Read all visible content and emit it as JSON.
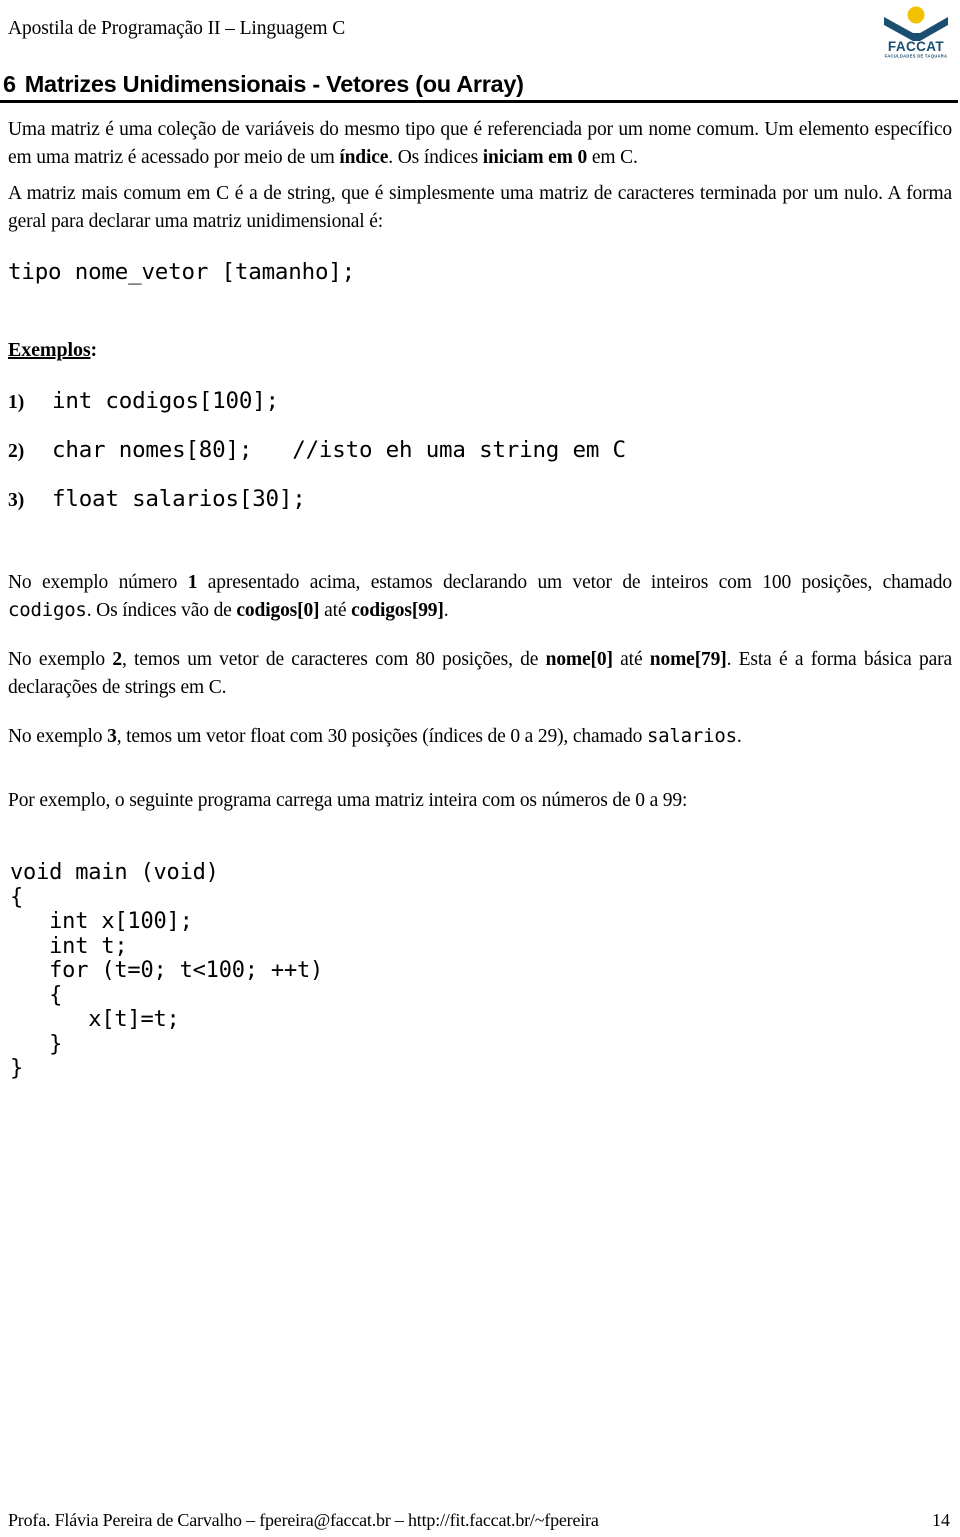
{
  "header": {
    "title": "Apostila de Programação II – Linguagem C",
    "logo": {
      "name": "FACCAT",
      "tagline": "FACULDADES DE TAQUARA",
      "colors": {
        "blue": "#1b4f72",
        "yellow": "#f2c200"
      }
    }
  },
  "section": {
    "number": "6",
    "title": "Matrizes Unidimensionais - Vetores (ou Array)"
  },
  "paragraphs": {
    "intro_a": "Uma matriz é uma coleção de variáveis do mesmo tipo que é referenciada por um nome comum. Um elemento específico em uma matriz é acessado por meio de um ",
    "intro_a_b1": "índice",
    "intro_a_mid": ". Os índices ",
    "intro_a_b2": "iniciam em 0",
    "intro_a_end": " em C.",
    "intro_b": "A matriz mais comum em C é a de string, que é simplesmente uma matriz de caracteres terminada por um nulo. A forma geral para declarar uma matriz unidimensional é:"
  },
  "declaration": "tipo nome_vetor [tamanho];",
  "examples_heading": {
    "label": "Exemplos",
    "colon": ":"
  },
  "examples": [
    {
      "num": "1)",
      "code": "int codigos[100];"
    },
    {
      "num": "2)",
      "code": "char nomes[80];   //isto eh uma string em C"
    },
    {
      "num": "3)",
      "code": "float salarios[30];"
    }
  ],
  "explanations": {
    "ex1_a": "No exemplo número ",
    "ex1_n": "1",
    "ex1_b": " apresentado acima, estamos declarando um vetor de inteiros com 100 posições, chamado ",
    "ex1_code": "codigos",
    "ex1_c": ". Os índices vão de ",
    "ex1_b1": "codigos[0]",
    "ex1_d": " até ",
    "ex1_b2": "codigos[99]",
    "ex1_e": ".",
    "ex2_a": "No exemplo ",
    "ex2_n": "2",
    "ex2_b": ", temos um vetor de caracteres com 80 posições, de ",
    "ex2_b1": "nome[0]",
    "ex2_c": " até ",
    "ex2_b2": "nome[79]",
    "ex2_d": ". Esta é a forma básica para declarações de strings em C.",
    "ex3_a": "No exemplo ",
    "ex3_n": "3",
    "ex3_b": ", temos um vetor float com 30 posições (índices de 0 a 29), chamado ",
    "ex3_code": "salarios",
    "ex3_c": ".",
    "program_intro": "Por exemplo, o seguinte programa carrega uma matriz inteira com os números de 0 a 99:"
  },
  "program_code": "void main (void)\n{\n   int x[100];\n   int t;\n   for (t=0; t<100; ++t)\n   {\n      x[t]=t;\n   }\n}",
  "footer": {
    "credits": "Profa. Flávia Pereira de Carvalho – fpereira@faccat.br – http://fit.faccat.br/~fpereira",
    "page": "14"
  }
}
